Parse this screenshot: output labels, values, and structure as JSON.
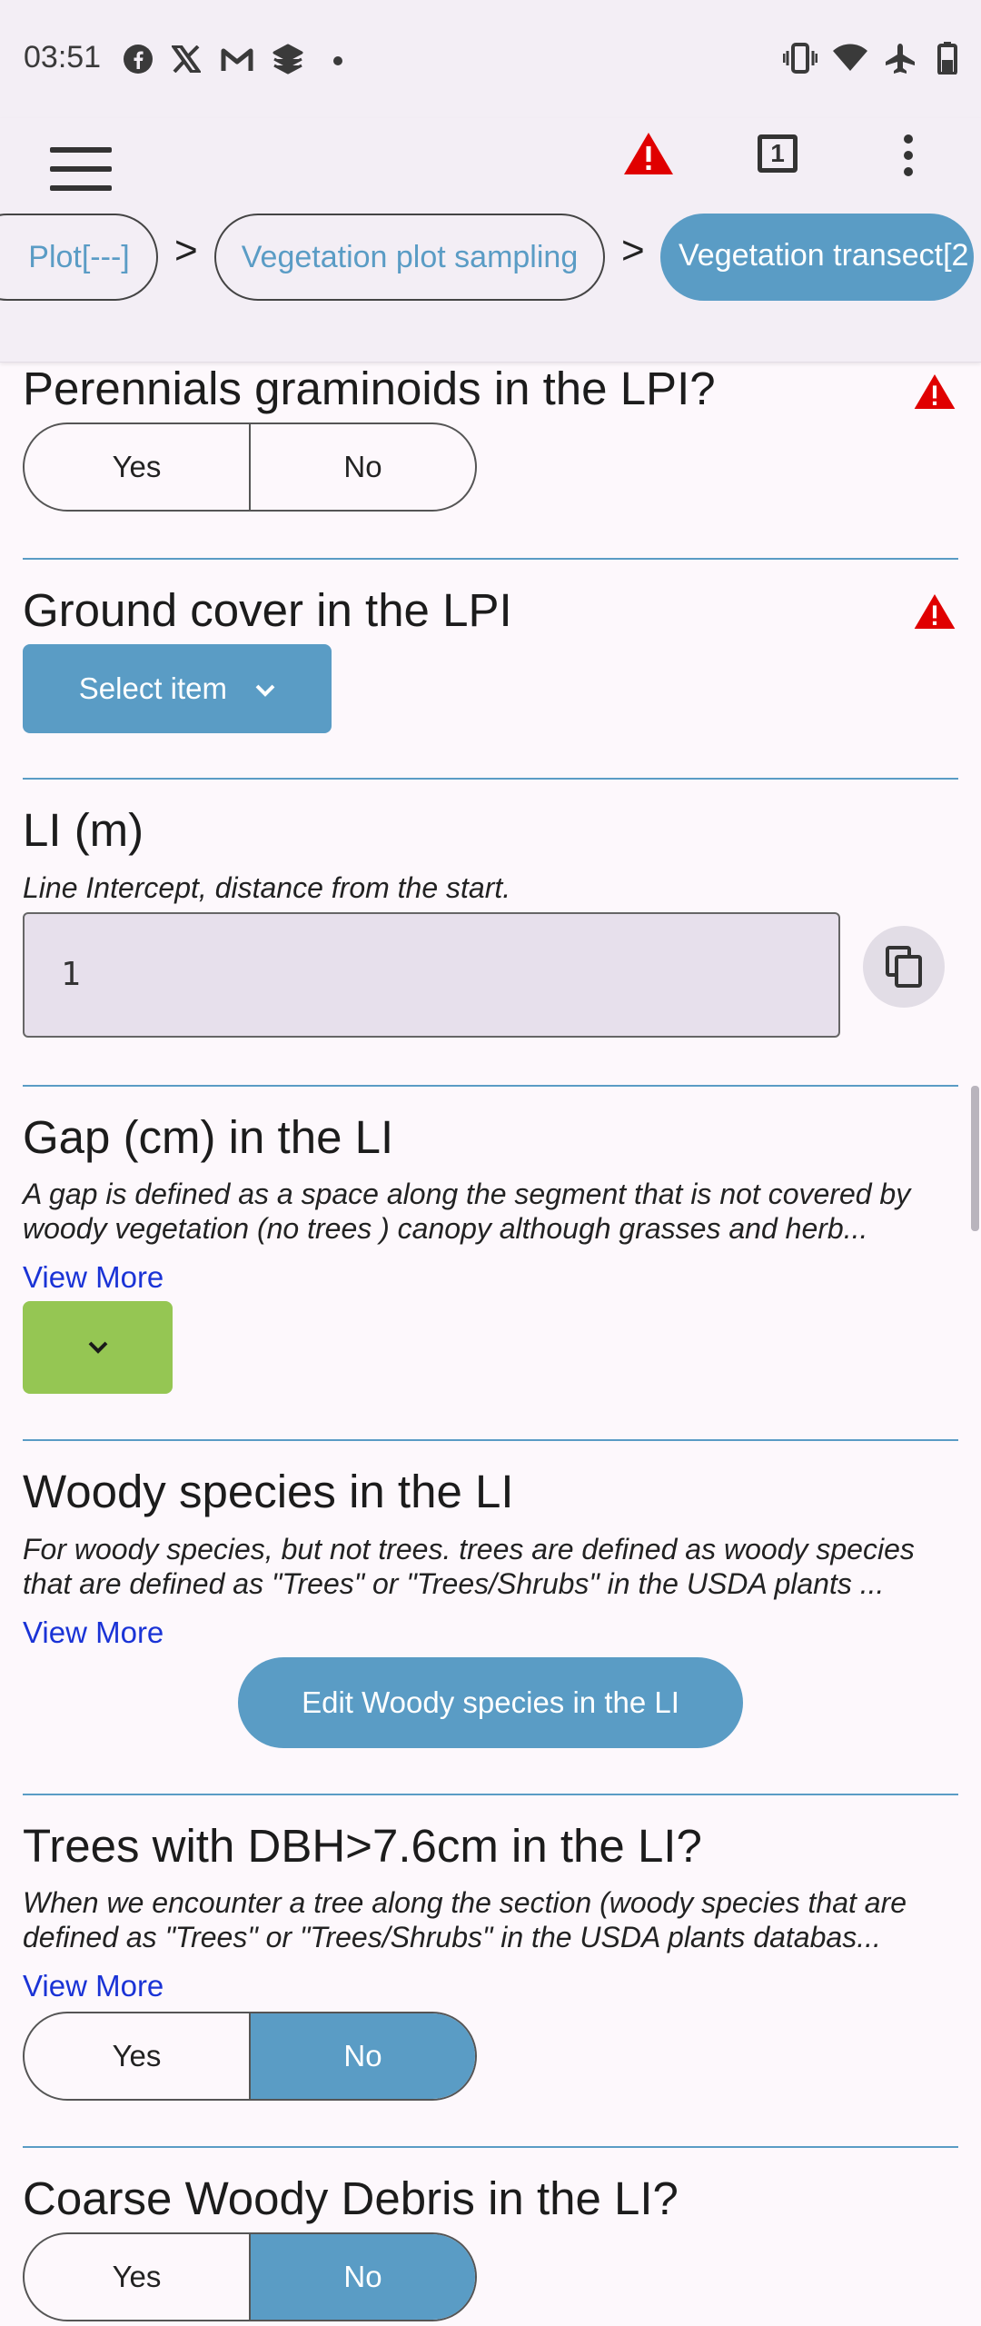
{
  "status_bar": {
    "time": "03:51",
    "apps": [
      "facebook-icon",
      "x-icon",
      "gmail-icon",
      "stack-icon",
      "dot"
    ]
  },
  "appbar": {
    "tabs_count": "1"
  },
  "breadcrumbs": [
    {
      "label": "Plot[---]"
    },
    {
      "label": "Vegetation plot sampling"
    },
    {
      "label": "Vegetation transect[2"
    }
  ],
  "breadcrumb_separator": ">",
  "questions": {
    "perennials": {
      "title": "Perennials graminoids in the LPI?",
      "yes": "Yes",
      "no": "No"
    },
    "ground_cover": {
      "title": "Ground cover in the LPI",
      "select_label": "Select item"
    },
    "li": {
      "title": "LI (m)",
      "description": "Line Intercept, distance from the start.",
      "value": "1"
    },
    "gap": {
      "title": "Gap (cm) in the LI",
      "description_1": "A gap is defined as a space along the segment that is not covered by",
      "description_2": "woody vegetation  (no trees ) canopy although grasses and herb...",
      "view_more": "View More"
    },
    "woody": {
      "title": "Woody species in the LI",
      "description_1": "For woody species, but not trees. trees are defined as woody species",
      "description_2": "that are defined as \"Trees\" or \"Trees/Shrubs\" in the USDA plants ...",
      "view_more": "View More",
      "edit_label": "Edit Woody species in the LI"
    },
    "trees": {
      "title": "Trees with DBH>7.6cm in the LI?",
      "description_1": "When we encounter a tree along the section (woody species that are",
      "description_2": "defined as \"Trees\" or \"Trees/Shrubs\" in the USDA plants databas...",
      "view_more": "View More",
      "yes": "Yes",
      "no": "No"
    },
    "debris": {
      "title": "Coarse Woody Debris in the LI?",
      "yes": "Yes",
      "no": "No"
    }
  },
  "colors": {
    "accent": "#5a9cc5",
    "warning": "#e00000",
    "green": "#95c653",
    "link": "#1a33d6"
  }
}
